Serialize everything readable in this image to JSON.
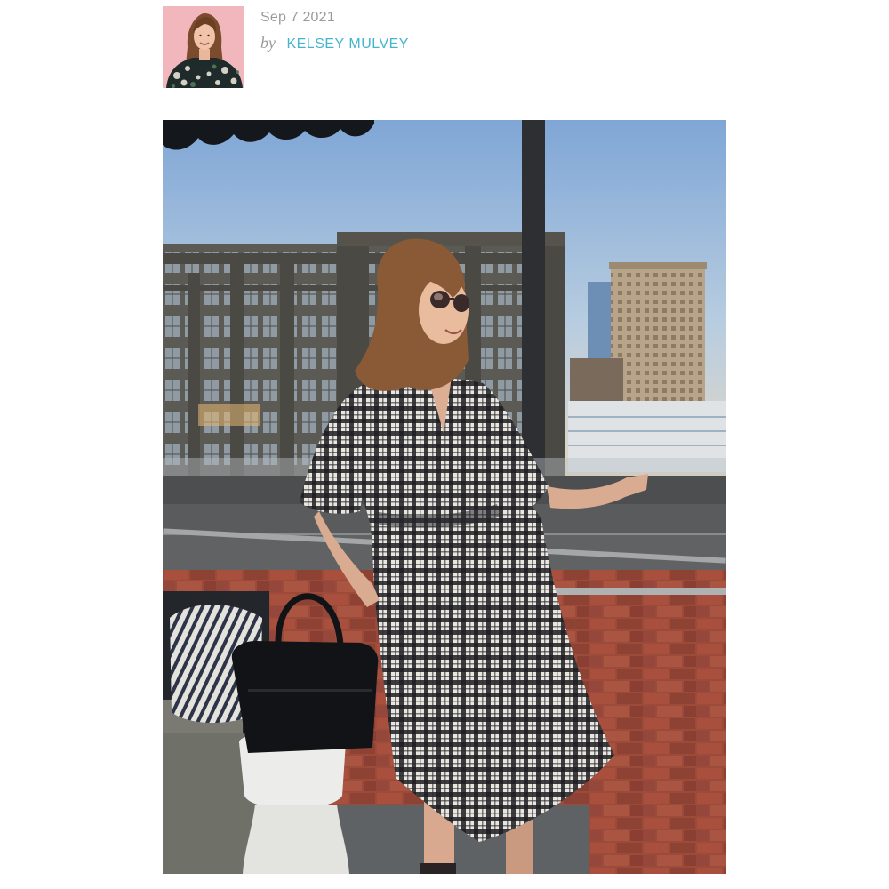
{
  "post": {
    "date": "Sep 7 2021",
    "by_label": "by",
    "author_name": "KELSEY MULVEY"
  },
  "colors": {
    "author_link": "#45b4cd",
    "meta_text": "#9a9a9a",
    "avatar_background": "#f3b9c0"
  },
  "media": {
    "avatar": "author-headshot",
    "main_photo": "outfit-photo-rooftop"
  }
}
